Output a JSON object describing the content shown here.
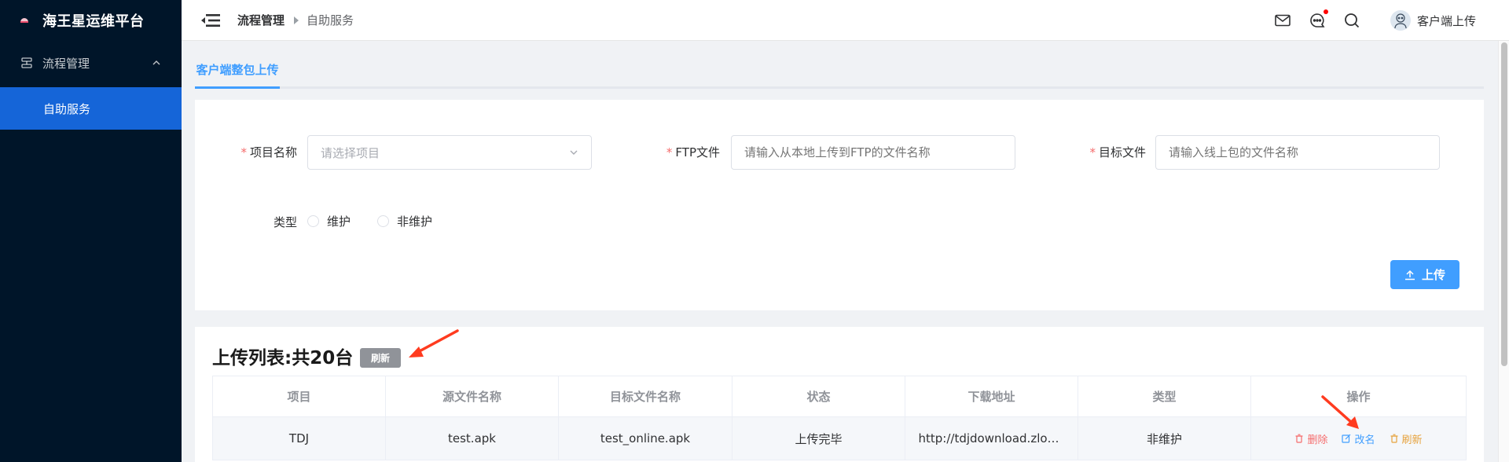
{
  "sidebar": {
    "app_title": "海王星运维平台",
    "group_label": "流程管理",
    "active_item": "自助服务"
  },
  "header": {
    "breadcrumb": [
      "流程管理",
      "自助服务"
    ],
    "username": "客户端上传",
    "icons": [
      "menu-fold-icon",
      "mail-icon",
      "chat-icon",
      "search-icon",
      "avatar"
    ]
  },
  "tabs": [
    {
      "label": "客户端整包上传",
      "active": true
    }
  ],
  "form": {
    "project": {
      "label": "项目名称",
      "placeholder": "请选择项目"
    },
    "ftp": {
      "label": "FTP文件",
      "placeholder": "请输入从本地上传到FTP的文件名称"
    },
    "target": {
      "label": "目标文件",
      "placeholder": "请输入线上包的文件名称"
    },
    "type": {
      "label": "类型",
      "options": [
        "维护",
        "非维护"
      ]
    },
    "upload_label": "上传"
  },
  "list": {
    "title": "上传列表:共20台",
    "refresh_label": "刷新",
    "columns": [
      "项目",
      "源文件名称",
      "目标文件名称",
      "状态",
      "下载地址",
      "类型",
      "操作"
    ],
    "rows": [
      {
        "project": "TDJ",
        "source": "test.apk",
        "target": "test_online.apk",
        "status": "上传完毕",
        "url": "http://tdjdownload.zlongame.com/test_online.apk",
        "type": "非维护",
        "actions": {
          "delete": "删除",
          "rename": "改名",
          "refresh": "刷新"
        }
      }
    ]
  },
  "colors": {
    "sidebar_bg": "#001529",
    "active_menu": "#1565d8",
    "primary": "#409eff",
    "danger": "#f56c6c",
    "warning": "#e6a23c",
    "annotation": "#ff3b1f"
  }
}
